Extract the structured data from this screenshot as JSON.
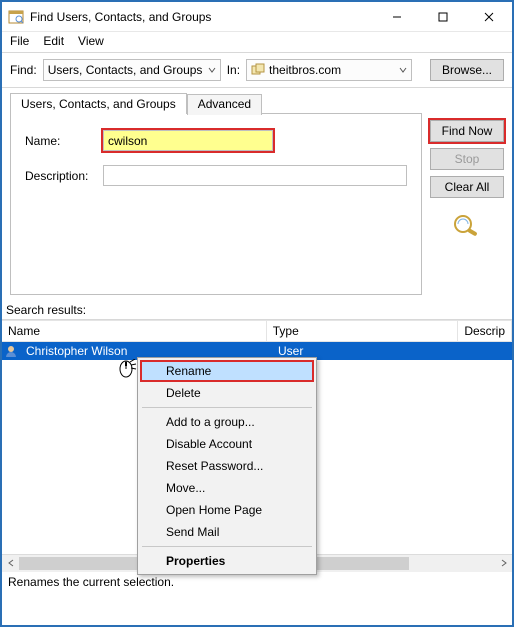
{
  "window": {
    "title": "Find Users, Contacts, and Groups"
  },
  "menubar": {
    "file": "File",
    "edit": "Edit",
    "view": "View"
  },
  "toolbar": {
    "find_label": "Find:",
    "find_combo": "Users, Contacts, and Groups",
    "in_label": "In:",
    "in_combo": "theitbros.com",
    "browse": "Browse..."
  },
  "tabs": {
    "users": "Users, Contacts, and Groups",
    "advanced": "Advanced"
  },
  "form": {
    "name_label": "Name:",
    "name_value": "cwilson",
    "desc_label": "Description:",
    "desc_value": ""
  },
  "sidebuttons": {
    "find_now": "Find Now",
    "stop": "Stop",
    "clear_all": "Clear All"
  },
  "results": {
    "label": "Search results:",
    "columns": {
      "name": "Name",
      "type": "Type",
      "desc": "Descrip"
    },
    "rows": [
      {
        "name": "Christopher Wilson",
        "type": "User",
        "desc": ""
      }
    ]
  },
  "context_menu": {
    "rename": "Rename",
    "delete": "Delete",
    "add_group": "Add to a group...",
    "disable": "Disable Account",
    "reset_pw": "Reset Password...",
    "move": "Move...",
    "open_home": "Open Home Page",
    "send_mail": "Send Mail",
    "properties": "Properties"
  },
  "statusbar": {
    "text": "Renames the current selection."
  }
}
